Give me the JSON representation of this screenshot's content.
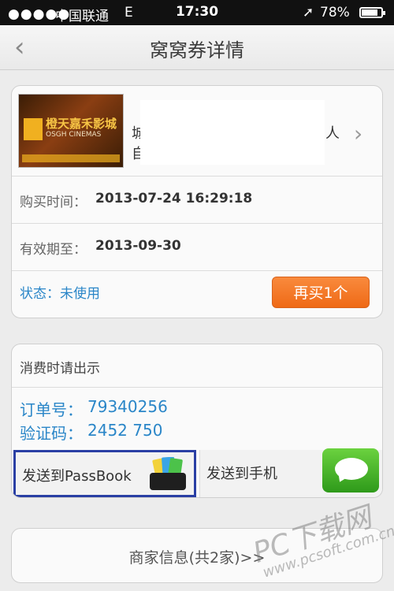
{
  "status_bar": {
    "signal": "●●●●●",
    "carrier": "中国联通",
    "network": "E",
    "time": "17:30",
    "location_icon": "location-arrow-icon",
    "battery": "78%"
  },
  "nav": {
    "back_icon": "chevron-left-icon",
    "title": "窝窝券详情"
  },
  "deal": {
    "thumbnail_brand": "橙天嘉禾影城",
    "thumbnail_brand_en": "OSGH CINEMAS",
    "fragment_left_1": "城",
    "fragment_left_2": "自",
    "fragment_right": "人",
    "purchase_label": "购买时间：",
    "purchase_time": "2013-07-24 16:29:18",
    "valid_label": "有效期至：",
    "valid_until": "2013-09-30",
    "status_text": "状态：未使用",
    "buy_again": "再买1个"
  },
  "voucher": {
    "hint": "消费时请出示",
    "order_label": "订单号：",
    "order_no": "79340256",
    "code_label": "验证码：",
    "code": "2452 750",
    "send_passbook": "发送到PassBook",
    "send_phone": "发送到手机"
  },
  "merchant": {
    "label": "商家信息(共2家)>>"
  },
  "watermark": {
    "title": "PC下载网",
    "url": "www.pcsoft.com.cn"
  },
  "colors": {
    "accent_blue": "#2a86c8",
    "button_orange": "#f27a28",
    "highlight_border": "#2a3fa4"
  }
}
